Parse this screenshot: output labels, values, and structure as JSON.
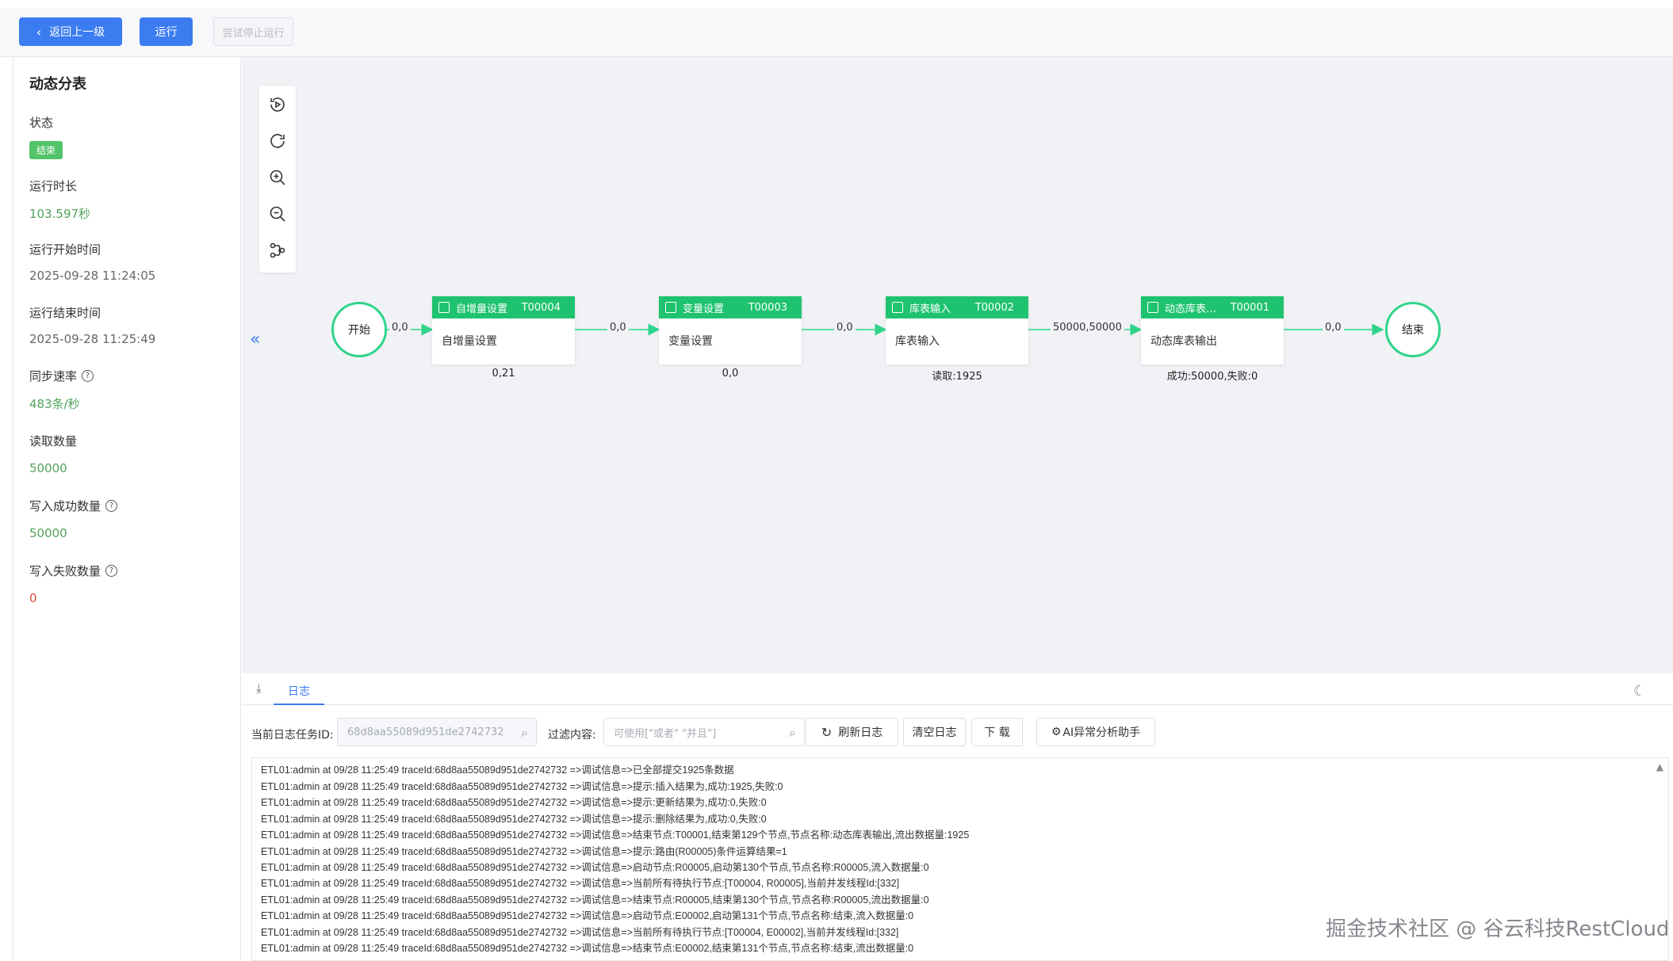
{
  "toolbar": {
    "back_label": "返回上一级",
    "run_label": "运行",
    "stop_label": "尝试停止运行"
  },
  "left": {
    "title": "动态分表",
    "status_label": "状态",
    "status_value": "结束",
    "duration_label": "运行时长",
    "duration_value": "103.597秒",
    "start_label": "运行开始时间",
    "start_value": "2025-09-28 11:24:05",
    "end_label": "运行结束时间",
    "end_value": "2025-09-28 11:25:49",
    "rate_label": "同步速率",
    "rate_value": "483条/秒",
    "read_label": "读取数量",
    "read_value": "50000",
    "write_ok_label": "写入成功数量",
    "write_ok_value": "50000",
    "write_fail_label": "写入失败数量",
    "write_fail_value": "0"
  },
  "flow": {
    "start": "开始",
    "end": "结束",
    "collapse": "«",
    "nodes": [
      {
        "title": "自增量设置",
        "id": "T00004",
        "body": "自增量设置",
        "stat": "0,21"
      },
      {
        "title": "变量设置",
        "id": "T00003",
        "body": "变量设置",
        "stat": "0,0"
      },
      {
        "title": "库表输入",
        "id": "T00002",
        "body": "库表输入",
        "stat": "读取:1925"
      },
      {
        "title": "动态库表…",
        "id": "T00001",
        "body": "动态库表输出",
        "stat": "成功:50000,失败:0"
      }
    ],
    "edges": [
      "0,0",
      "0,0",
      "0,0",
      "50000,50000",
      "0,0"
    ]
  },
  "log": {
    "tab_download": "⤓",
    "tab_label": "日志",
    "task_id_label": "当前日志任务ID:",
    "task_id_value": "68d8aa55089d951de2742732",
    "filter_label": "过滤内容:",
    "filter_placeholder": "可使用[\"或者\" \"并且\"]",
    "refresh_label": "刷新日志",
    "clear_label": "清空日志",
    "download_label": "下 载",
    "ai_label": "AI异常分析助手",
    "lines": [
      "ETL01:admin at 09/28 11:25:49 traceId:68d8aa55089d951de2742732 =>调试信息=>已全部提交1925条数据",
      "ETL01:admin at 09/28 11:25:49 traceId:68d8aa55089d951de2742732 =>调试信息=>提示:插入结果为,成功:1925,失败:0",
      "ETL01:admin at 09/28 11:25:49 traceId:68d8aa55089d951de2742732 =>调试信息=>提示:更新结果为,成功:0,失败:0",
      "ETL01:admin at 09/28 11:25:49 traceId:68d8aa55089d951de2742732 =>调试信息=>提示:删除结果为,成功:0,失败:0",
      "ETL01:admin at 09/28 11:25:49 traceId:68d8aa55089d951de2742732 =>调试信息=>结束节点:T00001,结束第129个节点,节点名称:动态库表输出,流出数据量:1925",
      "ETL01:admin at 09/28 11:25:49 traceId:68d8aa55089d951de2742732 =>调试信息=>提示:路由(R00005)条件运算结果=1",
      "ETL01:admin at 09/28 11:25:49 traceId:68d8aa55089d951de2742732 =>调试信息=>启动节点:R00005,启动第130个节点,节点名称:R00005,流入数据量:0",
      "ETL01:admin at 09/28 11:25:49 traceId:68d8aa55089d951de2742732 =>调试信息=>当前所有待执行节点:[T00004, R00005],当前并发线程Id:[332]",
      "ETL01:admin at 09/28 11:25:49 traceId:68d8aa55089d951de2742732 =>调试信息=>结束节点:R00005,结束第130个节点,节点名称:R00005,流出数据量:0",
      "ETL01:admin at 09/28 11:25:49 traceId:68d8aa55089d951de2742732 =>调试信息=>启动节点:E00002,启动第131个节点,节点名称:结束,流入数据量:0",
      "ETL01:admin at 09/28 11:25:49 traceId:68d8aa55089d951de2742732 =>调试信息=>当前所有待执行节点:[T00004, E00002],当前并发线程Id:[332]",
      "ETL01:admin at 09/28 11:25:49 traceId:68d8aa55089d951de2742732 =>调试信息=>结束节点:E00002,结束第131个节点,节点名称:结束,流出数据量:0"
    ]
  },
  "watermark": "掘金技术社区 @ 谷云科技RestCloud"
}
